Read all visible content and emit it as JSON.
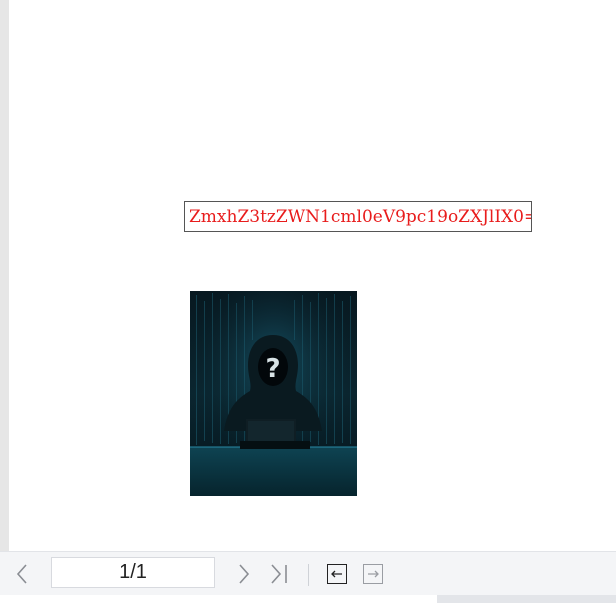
{
  "document": {
    "encoded_text": "ZmxhZ3tzZWN1cml0eV9pc19oZXJlIX0="
  },
  "image": {
    "icon": "hooded-hacker-image",
    "colors": {
      "background": "#061116",
      "accent": "#1b6e85"
    }
  },
  "toolbar": {
    "page_indicator": "1/1",
    "icons": {
      "prev": "chevron-left-icon",
      "next": "chevron-right-icon",
      "last": "last-page-icon",
      "fit_left": "arrow-left-box-icon",
      "fit_right": "arrow-right-box-icon"
    }
  },
  "colors": {
    "text_red": "#e81c1c",
    "toolbar_bg": "#f4f5f7"
  }
}
